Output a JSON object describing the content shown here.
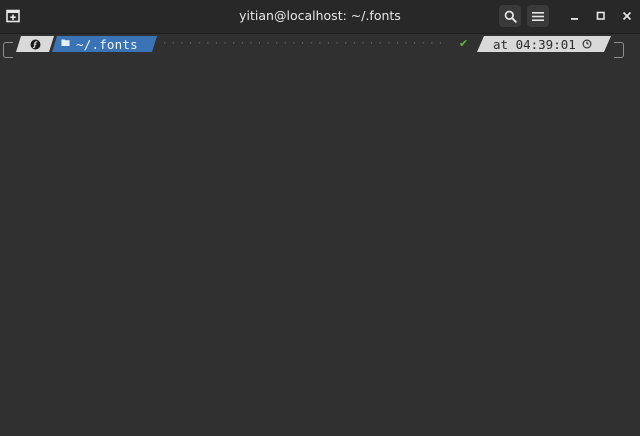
{
  "window": {
    "title": "yitian@localhost: ~/.fonts",
    "icons": {
      "new_tab": "new-tab-icon",
      "search": "search-icon",
      "menu": "hamburger-menu-icon",
      "minimize": "minimize-icon",
      "maximize": "maximize-icon",
      "close": "close-icon"
    }
  },
  "prompt": {
    "os_icon": "fedora-logo-icon",
    "dir_icon": "folder-icon",
    "dir_icon_glyph": "🖿",
    "cwd": "~/.fonts",
    "dots": "··································",
    "status_icon": "checkmark-icon",
    "status_glyph": "✔",
    "time_text": "at 04:39:01",
    "time_icon": "clock-icon",
    "colors": {
      "dir_segment": "#3a73b6",
      "light_segment": "#d9d9d9",
      "status_ok": "#5fb83a",
      "terminal_bg": "#303030"
    }
  }
}
